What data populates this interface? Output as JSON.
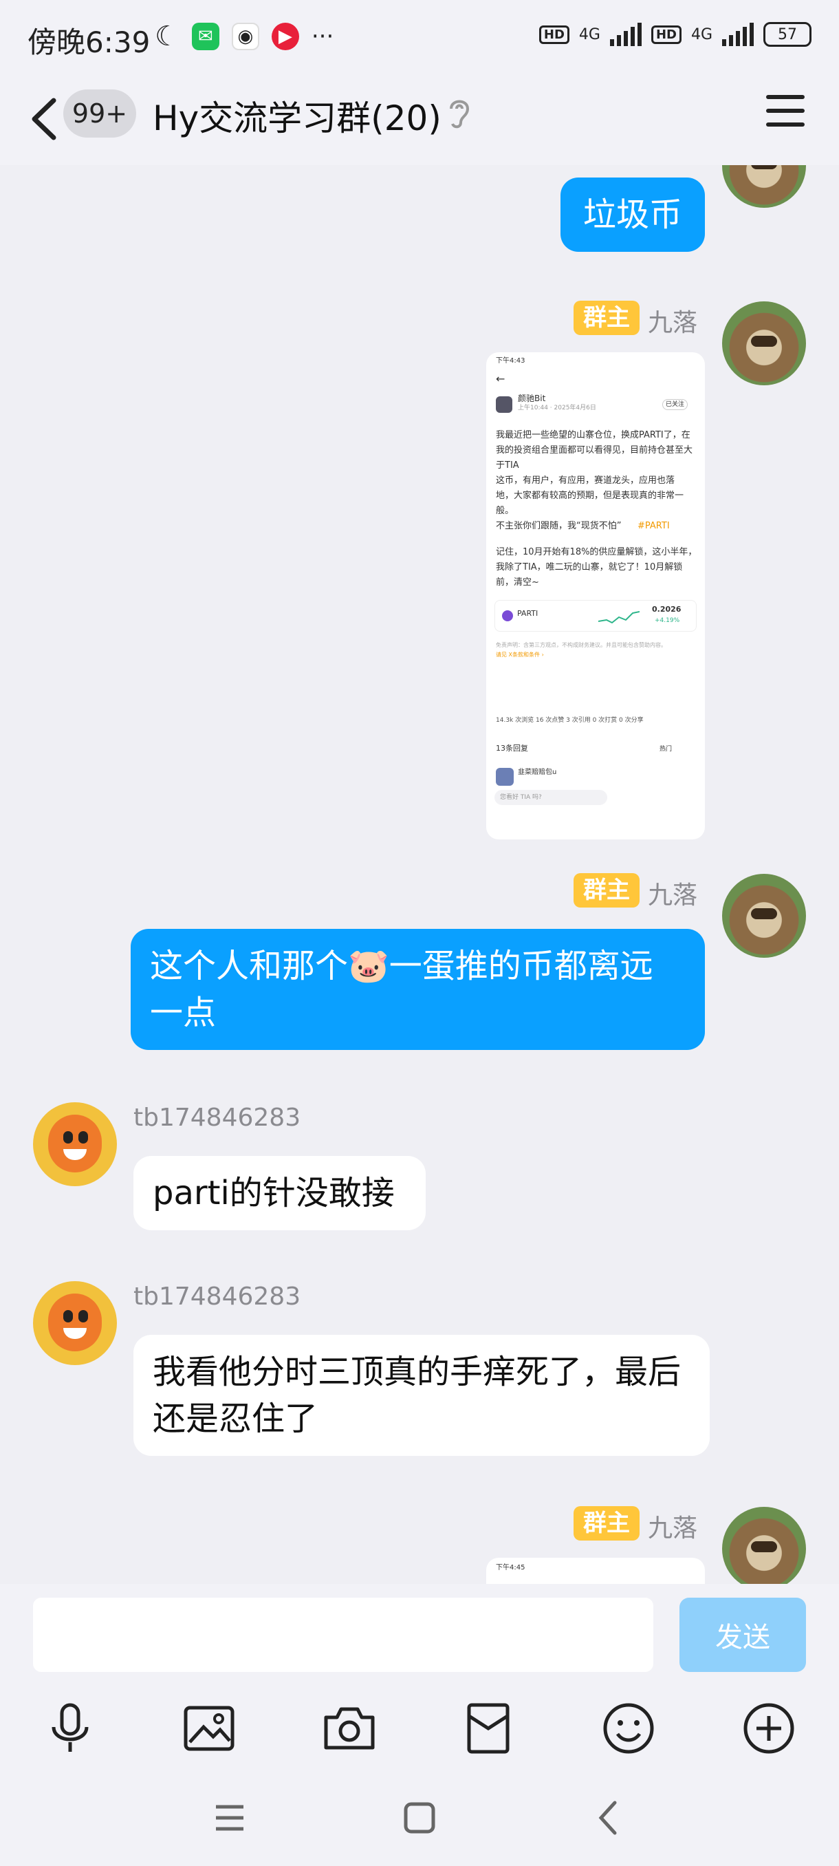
{
  "status_bar": {
    "time": "傍晚6:39",
    "network_1": "4G",
    "network_2": "4G",
    "hd_1": "HD",
    "hd_2": "HD",
    "battery": "57",
    "more": "···"
  },
  "header": {
    "unread_badge": "99+",
    "title": "Hy交流学习群(20)"
  },
  "messages": [
    {
      "sender": "me",
      "text": "垃圾币"
    },
    {
      "sender_name": "九落",
      "role_badge": "群主",
      "type": "image"
    },
    {
      "sender_name": "九落",
      "role_badge": "群主",
      "text": "这个人和那个🐷一蛋推的币都离远一点"
    },
    {
      "sender_name": "tb174846283",
      "text": "parti的针没敢接"
    },
    {
      "sender_name": "tb174846283",
      "text": "我看他分时三顶真的手痒死了，最后还是忍住了"
    },
    {
      "sender_name": "九落",
      "role_badge": "群主",
      "type": "image"
    }
  ],
  "shot": {
    "status": "下午4:43",
    "author": "颜驰Bit",
    "time": "上午10:44 · 2025年4月6日",
    "follow": "已关注",
    "p1": "我最近把一些绝望的山寨仓位，换成PARTI了，在",
    "p2": "我的投资组合里面都可以看得见，目前持仓甚至大",
    "p3": "于TIA",
    "p4": "这币，有用户，有应用，赛道龙头，应用也落",
    "p5": "地，大家都有较高的预期，但是表现真的非常一",
    "p6": "般。",
    "p7": "不主张你们跟随，我“现货不怕”",
    "tag": "#PARTI",
    "p8": "记住，10月开始有18%的供应量解锁，这小半年，",
    "p9": "我除了TIA，唯二玩的山寨，就它了！10月解锁",
    "p10": "前，清空~",
    "coin": "PARTI",
    "price": "0.2026",
    "change": "+4.19%",
    "disclaimer": "免责声明：含第三方观点，不构成财务建议。并且可能包含赞助内容。",
    "terms": "请见 X条款和条件 ›",
    "stats": "14.3k 次浏览  16 次点赞  3 次引用  0 次打赏  0 次分享",
    "replies": "13条回复",
    "hot": "热门",
    "commenter": "韭菜赔赔包u",
    "input_ph": "您看好 TIA 吗?",
    "status2": "下午4:45"
  },
  "input": {
    "send_label": "发送"
  }
}
